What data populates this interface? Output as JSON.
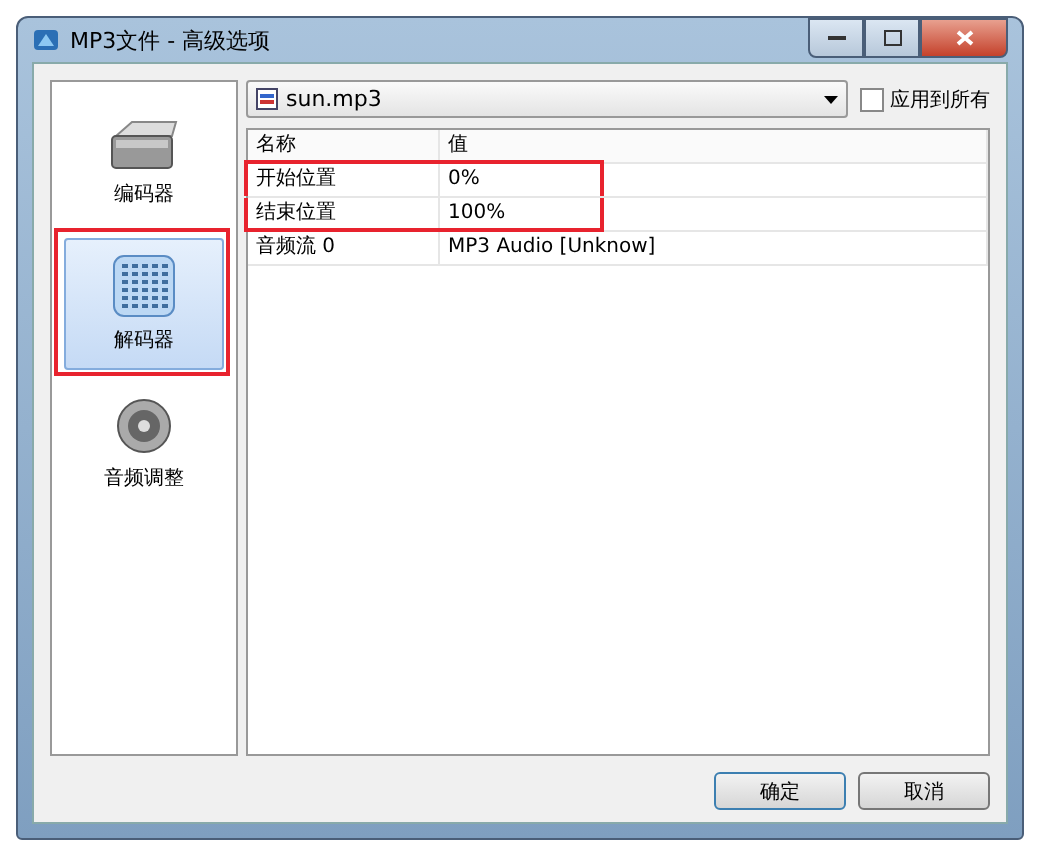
{
  "window": {
    "title": "MP3文件 - 高级选项"
  },
  "sidebar": {
    "items": [
      {
        "label": "编码器",
        "kind": "disk",
        "selected": false,
        "highlighted": false
      },
      {
        "label": "解码器",
        "kind": "grid",
        "selected": true,
        "highlighted": true
      },
      {
        "label": "音频调整",
        "kind": "speaker",
        "selected": false,
        "highlighted": false
      }
    ]
  },
  "file_select": {
    "value": "sun.mp3"
  },
  "apply_all": {
    "label": "应用到所有",
    "checked": false
  },
  "table": {
    "columns": [
      "名称",
      "值"
    ],
    "rows": [
      {
        "cells": [
          "开始位置",
          "0%"
        ],
        "highlighted": true
      },
      {
        "cells": [
          "结束位置",
          "100%"
        ],
        "highlighted": true
      },
      {
        "cells": [
          "音频流 0",
          "MP3 Audio [Unknow]"
        ],
        "highlighted": false
      }
    ]
  },
  "buttons": [
    "确定",
    "取消"
  ]
}
